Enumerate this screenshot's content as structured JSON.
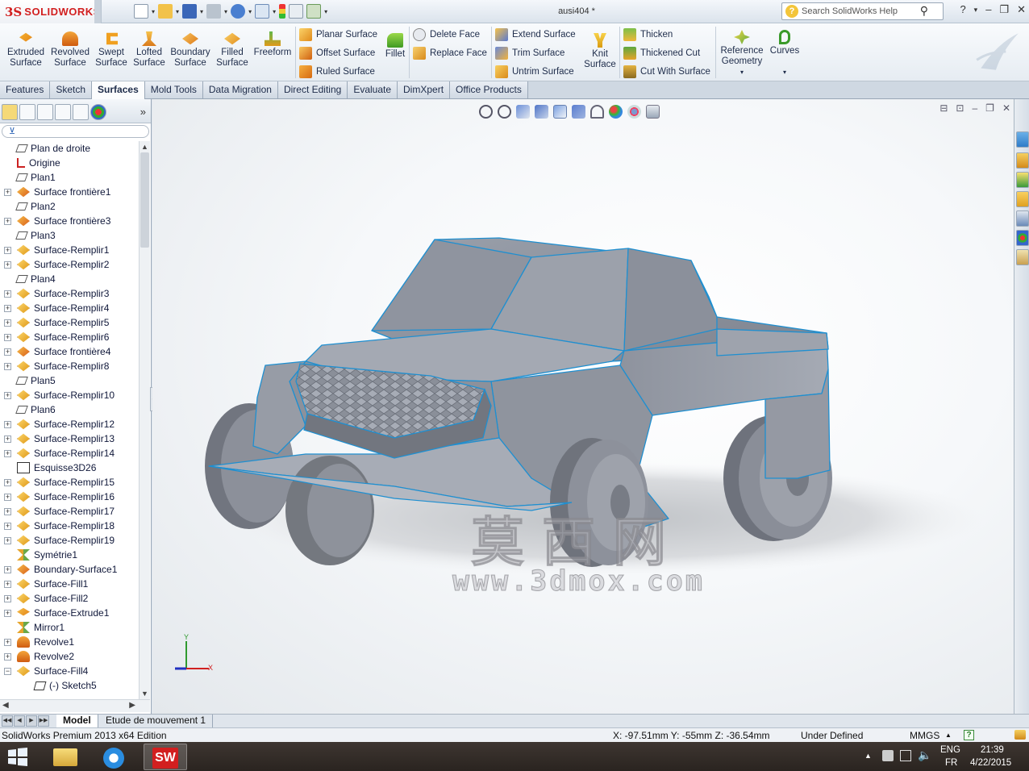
{
  "app": {
    "logo_ds": "3S",
    "logo_text": "SOLIDWORKS",
    "document_title": "ausi404 *",
    "search_placeholder": "Search SolidWorks Help"
  },
  "command_manager": {
    "big_buttons": [
      {
        "line1": "Extruded",
        "line2": "Surface"
      },
      {
        "line1": "Revolved",
        "line2": "Surface"
      },
      {
        "line1": "Swept",
        "line2": "Surface"
      },
      {
        "line1": "Lofted",
        "line2": "Surface"
      },
      {
        "line1": "Boundary",
        "line2": "Surface"
      },
      {
        "line1": "Filled",
        "line2": "Surface"
      },
      {
        "line1": "Freeform",
        "line2": ""
      }
    ],
    "small_buttons": {
      "planar_surface": "Planar Surface",
      "offset_surface": "Offset Surface",
      "ruled_surface": "Ruled Surface",
      "fillet": "Fillet",
      "delete_face": "Delete Face",
      "replace_face": "Replace Face",
      "extend_surface": "Extend Surface",
      "trim_surface": "Trim Surface",
      "untrim_surface": "Untrim Surface",
      "knit_line1": "Knit",
      "knit_line2": "Surface",
      "thicken": "Thicken",
      "thickened_cut": "Thickened Cut",
      "cut_with_surface": "Cut With Surface",
      "reference_line1": "Reference",
      "reference_line2": "Geometry",
      "curves": "Curves"
    }
  },
  "tabs": [
    "Features",
    "Sketch",
    "Surfaces",
    "Mold Tools",
    "Data Migration",
    "Direct Editing",
    "Evaluate",
    "DimXpert",
    "Office Products"
  ],
  "active_tab": "Surfaces",
  "feature_tree": [
    {
      "label": "Plan de droite",
      "icon": "plane-icon",
      "expandable": false
    },
    {
      "label": "Origine",
      "icon": "origin-icon",
      "expandable": false
    },
    {
      "label": "Plan1",
      "icon": "plane-icon",
      "expandable": false
    },
    {
      "label": "Surface frontière1",
      "icon": "boundary-surface-icon",
      "expandable": true
    },
    {
      "label": "Plan2",
      "icon": "plane-icon",
      "expandable": false
    },
    {
      "label": "Surface frontière3",
      "icon": "boundary-surface-icon",
      "expandable": true
    },
    {
      "label": "Plan3",
      "icon": "plane-icon",
      "expandable": false
    },
    {
      "label": "Surface-Remplir1",
      "icon": "fill-surface-icon",
      "expandable": true
    },
    {
      "label": "Surface-Remplir2",
      "icon": "fill-surface-icon",
      "expandable": true
    },
    {
      "label": "Plan4",
      "icon": "plane-icon",
      "expandable": false
    },
    {
      "label": "Surface-Remplir3",
      "icon": "fill-surface-icon",
      "expandable": true
    },
    {
      "label": "Surface-Remplir4",
      "icon": "fill-surface-icon",
      "expandable": true
    },
    {
      "label": "Surface-Remplir5",
      "icon": "fill-surface-icon",
      "expandable": true
    },
    {
      "label": "Surface-Remplir6",
      "icon": "fill-surface-icon",
      "expandable": true
    },
    {
      "label": "Surface frontière4",
      "icon": "boundary-surface-icon",
      "expandable": true
    },
    {
      "label": "Surface-Remplir8",
      "icon": "fill-surface-icon",
      "expandable": true
    },
    {
      "label": "Plan5",
      "icon": "plane-icon",
      "expandable": false
    },
    {
      "label": "Surface-Remplir10",
      "icon": "fill-surface-icon",
      "expandable": true
    },
    {
      "label": "Plan6",
      "icon": "plane-icon",
      "expandable": false
    },
    {
      "label": "Surface-Remplir12",
      "icon": "fill-surface-icon",
      "expandable": true
    },
    {
      "label": "Surface-Remplir13",
      "icon": "fill-surface-icon",
      "expandable": true
    },
    {
      "label": "Surface-Remplir14",
      "icon": "fill-surface-icon",
      "expandable": true
    },
    {
      "label": "Esquisse3D26",
      "icon": "sketch3d-icon",
      "expandable": false
    },
    {
      "label": "Surface-Remplir15",
      "icon": "fill-surface-icon",
      "expandable": true
    },
    {
      "label": "Surface-Remplir16",
      "icon": "fill-surface-icon",
      "expandable": true
    },
    {
      "label": "Surface-Remplir17",
      "icon": "fill-surface-icon",
      "expandable": true
    },
    {
      "label": "Surface-Remplir18",
      "icon": "fill-surface-icon",
      "expandable": true
    },
    {
      "label": "Surface-Remplir19",
      "icon": "fill-surface-icon",
      "expandable": true
    },
    {
      "label": "Symétrie1",
      "icon": "mirror-icon",
      "expandable": false
    },
    {
      "label": "Boundary-Surface1",
      "icon": "boundary-surface-icon",
      "expandable": true
    },
    {
      "label": "Surface-Fill1",
      "icon": "fill-surface-icon",
      "expandable": true
    },
    {
      "label": "Surface-Fill2",
      "icon": "fill-surface-icon",
      "expandable": true
    },
    {
      "label": "Surface-Extrude1",
      "icon": "extrude-surface-icon",
      "expandable": true
    },
    {
      "label": "Mirror1",
      "icon": "mirror-icon",
      "expandable": false
    },
    {
      "label": "Revolve1",
      "icon": "revolve-icon",
      "expandable": true
    },
    {
      "label": "Revolve2",
      "icon": "revolve-icon",
      "expandable": true
    },
    {
      "label": "Surface-Fill4",
      "icon": "fill-surface-icon",
      "expandable": true,
      "expanded": true
    },
    {
      "label": "(-) Sketch5",
      "icon": "sketch-icon",
      "expandable": false,
      "child": true
    }
  ],
  "viewport": {
    "watermark_cn": "莫西网",
    "watermark_url": "www.3dmox.com",
    "triad_y": "Y",
    "triad_x": "X"
  },
  "model_tabs": [
    "Model",
    "Etude de mouvement 1"
  ],
  "status": {
    "edition": "SolidWorks Premium 2013 x64 Edition",
    "coords": "X: -97.51mm Y: -55mm Z: -36.54mm",
    "state": "Under Defined",
    "units": "MMGS"
  },
  "taskbar": {
    "lang1": "ENG",
    "lang2": "FR",
    "time": "21:39",
    "date": "4/22/2015"
  },
  "colors": {
    "accent": "#1f8fd0",
    "model_gray": "#8e929c",
    "brand_red": "#d21f1f"
  }
}
